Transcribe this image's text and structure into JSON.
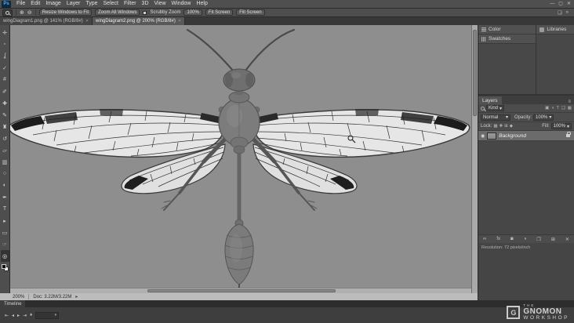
{
  "app": {
    "logo": "Ps"
  },
  "menubar": {
    "items": [
      "File",
      "Edit",
      "Image",
      "Layer",
      "Type",
      "Select",
      "Filter",
      "3D",
      "View",
      "Window",
      "Help"
    ]
  },
  "window_controls": {
    "minimize": "—",
    "maximize": "▢",
    "close": "✕"
  },
  "options": {
    "zoom_in": "⊕",
    "zoom_out": "⊖",
    "resize_windows": "Resize Windows to Fit",
    "zoom_all": "Zoom All Windows",
    "scrubby": "Scrubby Zoom",
    "pct": "100%",
    "fit": "Fit Screen",
    "fill": "Fill Screen",
    "panel_icon": "❏",
    "more_icon": "»"
  },
  "tabs": [
    {
      "label": "wingDiagram1.png @ 141% (RGB/8#)",
      "close": "✕"
    },
    {
      "label": "wingDiagram2.png @ 200% (RGB/8#)",
      "close": "✕"
    }
  ],
  "tools": [
    "✛",
    "▫",
    "ʆ",
    "✓",
    "#",
    "✐",
    "✚",
    "✎",
    "♜",
    "↺",
    "▱",
    "▥",
    "○",
    "◐",
    "✒",
    "T",
    "▸",
    "▭",
    "☞",
    "◎"
  ],
  "panels": {
    "color": "Color",
    "swatches": "Swatches",
    "libraries": "Libraries",
    "layers": {
      "tab": "Layers",
      "menu_icon": "≡",
      "kind": "Kind",
      "kind_arrow": "▾",
      "filter_icons": [
        "▣",
        "◑",
        "T",
        "❏",
        "▦"
      ],
      "blend": "Normal",
      "arrow": "▾",
      "opacity_label": "Opacity:",
      "opacity_value": "100%",
      "lock_label": "Lock:",
      "lock_icons": [
        "▦",
        "✚",
        "⊞",
        "◆"
      ],
      "fill_label": "Fill:",
      "fill_value": "100%",
      "layer": {
        "eye": "◉",
        "name": "Background"
      },
      "bottom_icons": [
        "∞",
        "fx",
        "◙",
        "◑",
        "❐",
        "⊞",
        "✕"
      ]
    },
    "resolution": "Resolution: 72 pixels/inch"
  },
  "status": {
    "zoom": "200%",
    "doc": "Doc: 3.22M/3.22M",
    "arrow": "▸"
  },
  "timeline": {
    "tab": "Timeline",
    "controls": [
      "⇤",
      "◂",
      "▸",
      "⇥",
      "♦"
    ],
    "dd_arrow": "▾"
  },
  "watermark": {
    "logo": "G",
    "the": "THE",
    "gnomon": "GNOMON",
    "workshop": "WORKSHOP"
  },
  "colors": {
    "canvas_bg": "#8e8e8e",
    "ui_bg": "#4f4f4f",
    "ui_dark": "#353535",
    "selection": "#6b6b6b",
    "wing_membrane": "#e6e6e6",
    "body_gray": "#7c7c7c"
  }
}
